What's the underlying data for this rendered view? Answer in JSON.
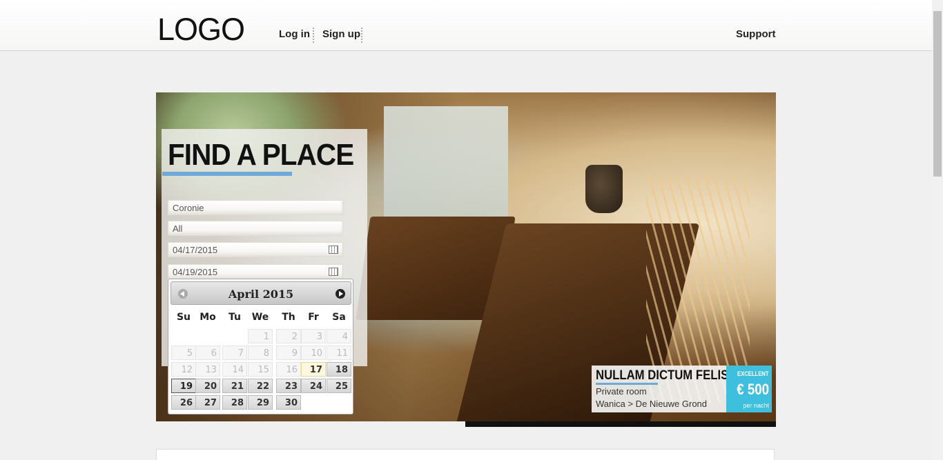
{
  "header": {
    "logo": "LOGO",
    "login": "Log in",
    "signup": "Sign up",
    "support": "Support"
  },
  "search": {
    "title": "FIND A PLACE",
    "location": "Coronie",
    "type": "All",
    "checkin": "04/17/2015",
    "checkout": "04/19/2015"
  },
  "datepicker": {
    "month_title": "April 2015",
    "weekdays": [
      "Su",
      "Mo",
      "Tu",
      "We",
      "Th",
      "Fr",
      "Sa"
    ],
    "days": [
      [
        "",
        "",
        "",
        "1",
        "2",
        "3",
        "4"
      ],
      [
        "5",
        "6",
        "7",
        "8",
        "9",
        "10",
        "11"
      ],
      [
        "12",
        "13",
        "14",
        "15",
        "16",
        "17",
        "18"
      ],
      [
        "19",
        "20",
        "21",
        "22",
        "23",
        "24",
        "25"
      ],
      [
        "26",
        "27",
        "28",
        "29",
        "30",
        "",
        ""
      ]
    ],
    "today": "17",
    "selected": "19",
    "first_active": 17
  },
  "listing": {
    "title": "NULLAM DICTUM FELIS",
    "room_type": "Private room",
    "location": "Wanica > De Nieuwe Grond",
    "rating": "EXCELLENT",
    "price": "€ 500",
    "price_unit": "per nacht"
  },
  "colors": {
    "accent_blue": "#6fa9d8",
    "price_bg": "#3fbfde"
  }
}
